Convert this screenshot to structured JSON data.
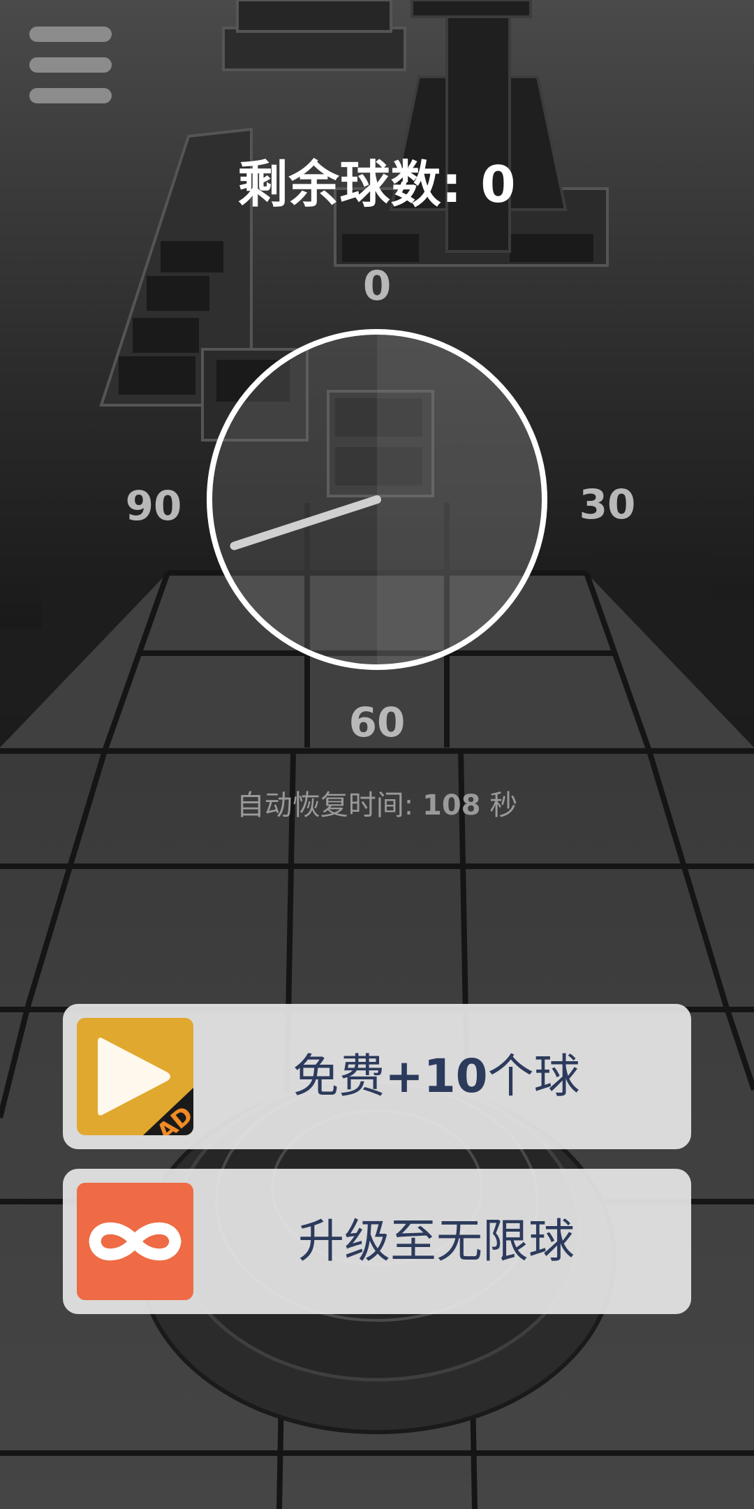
{
  "hud": {
    "balls_label": "剩余球数: ",
    "balls_count": "0",
    "recover_label": "自动恢复时间: ",
    "recover_seconds": "108",
    "recover_unit": " 秒"
  },
  "dial": {
    "top": "0",
    "right": "30",
    "bottom": "60",
    "left": "90",
    "needle_value": 84
  },
  "offers": {
    "free": {
      "prefix": "免费",
      "amount": "+10",
      "suffix": "个球",
      "badge": "AD",
      "icon": "play-icon"
    },
    "unlimited": {
      "label": "升级至无限球",
      "icon": "infinity-icon"
    }
  },
  "colors": {
    "ad_icon_bg": "#E0A82E",
    "unlimited_icon_bg": "#EE6B45",
    "offer_text": "#2C3A5C"
  }
}
